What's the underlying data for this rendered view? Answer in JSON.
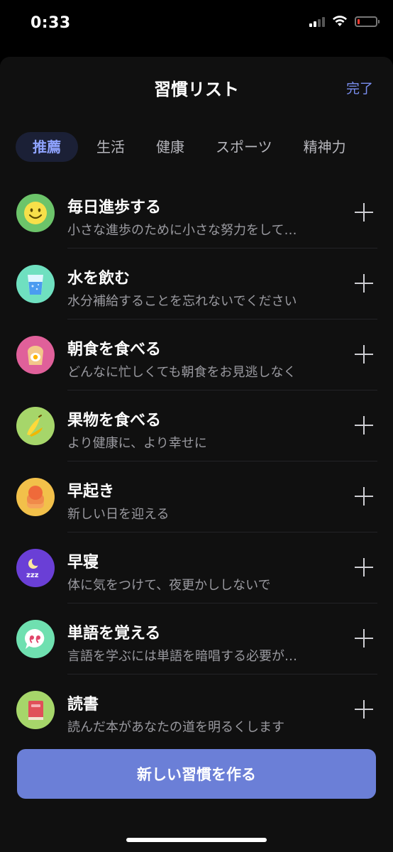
{
  "status_bar": {
    "time": "0:33"
  },
  "header": {
    "title": "習慣リスト",
    "done_label": "完了"
  },
  "tabs": [
    {
      "label": "推薦",
      "active": true
    },
    {
      "label": "生活",
      "active": false
    },
    {
      "label": "健康",
      "active": false
    },
    {
      "label": "スポーツ",
      "active": false
    },
    {
      "label": "精神力",
      "active": false
    }
  ],
  "habits": [
    {
      "title": "毎日進歩する",
      "desc": "小さな進歩のために小さな努力をして…",
      "icon": "smile-icon",
      "color": "#6cc46a"
    },
    {
      "title": "水を飲む",
      "desc": "水分補給することを忘れないでください",
      "icon": "water-glass-icon",
      "color": "#6fe0c0"
    },
    {
      "title": "朝食を食べる",
      "desc": "どんなに忙しくても朝食をお見逃しなく",
      "icon": "toast-egg-icon",
      "color": "#e0609a"
    },
    {
      "title": "果物を食べる",
      "desc": "より健康に、より幸せに",
      "icon": "banana-icon",
      "color": "#a6d66a"
    },
    {
      "title": "早起き",
      "desc": "新しい日を迎える",
      "icon": "sunrise-icon",
      "color": "#f2c04a"
    },
    {
      "title": "早寝",
      "desc": "体に気をつけて、夜更かししないで",
      "icon": "moon-sleep-icon",
      "color": "#6a3fd6"
    },
    {
      "title": "単語を覚える",
      "desc": "言語を学ぶには単語を暗唱する必要が…",
      "icon": "quote-bubble-icon",
      "color": "#6fe0b0"
    },
    {
      "title": "読書",
      "desc": "読んだ本があなたの道を明るくします",
      "icon": "book-icon",
      "color": "#a6d66a"
    }
  ],
  "create_button": {
    "label": "新しい習慣を作る",
    "color": "#6b7fd7"
  }
}
